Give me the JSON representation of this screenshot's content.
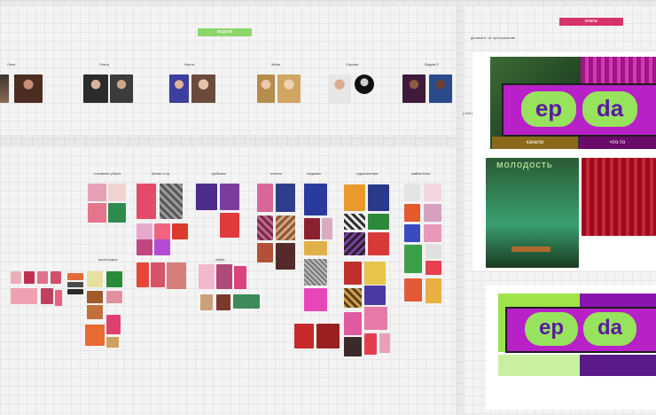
{
  "models": {
    "tag": "модели",
    "names": [
      "Лиля",
      "Ольга",
      "Настя",
      "Женя",
      "Сережа",
      "Вадим Е"
    ]
  },
  "clothes": {
    "categories": [
      "головные уборы",
      "брюки и тд",
      "рубашки",
      "платья",
      "пиджаки",
      "худи/свитера",
      "майки/топы",
      "аксессуары",
      "обувь"
    ]
  },
  "comps": {
    "tag": "компы",
    "note": "делаем в 'ти' пространстве",
    "side_note": "( сон )",
    "brand": [
      "ep",
      "da"
    ],
    "captions": [
      "качели",
      "что-то"
    ],
    "wall_text": "молодость"
  }
}
